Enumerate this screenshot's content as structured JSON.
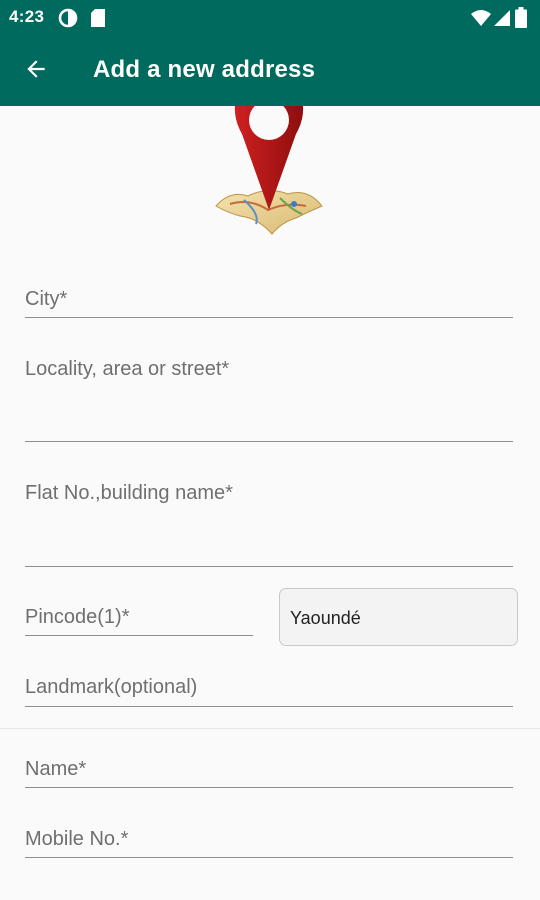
{
  "status_bar": {
    "time": "4:23",
    "icons": [
      "data-saver-icon",
      "sim-card-icon",
      "wifi-icon",
      "signal-icon",
      "battery-icon"
    ]
  },
  "app_bar": {
    "title": "Add a new address",
    "back_icon": "arrow-left-icon",
    "background_color": "#006a5e"
  },
  "illustration": "map-pin-icon",
  "form": {
    "city": {
      "placeholder": "City*"
    },
    "locality": {
      "placeholder": "Locality, area or street*"
    },
    "flat": {
      "placeholder": "Flat No.,building name*"
    },
    "pincode": {
      "placeholder": "Pincode(1)*"
    },
    "city_select": {
      "value": "Yaoundé"
    },
    "landmark": {
      "placeholder": "Landmark(optional)"
    },
    "name": {
      "placeholder": "Name*"
    },
    "mobile": {
      "placeholder": "Mobile No.*"
    }
  }
}
